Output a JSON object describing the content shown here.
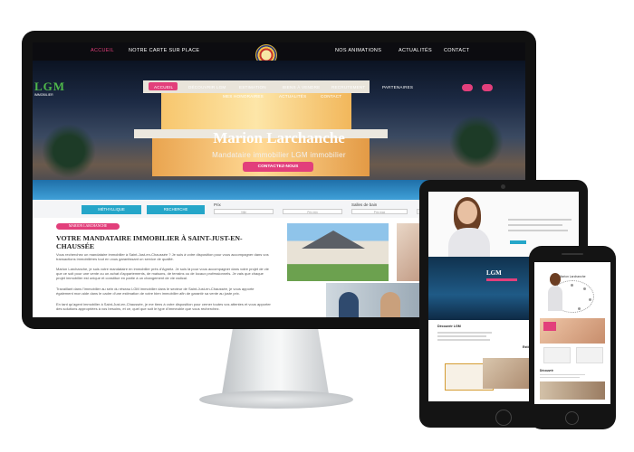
{
  "topbar": {
    "items": [
      "ACCUEIL",
      "NOTRE CARTE SUR PLACE",
      "NOS ANIMATIONS",
      "ACTUALITÉS",
      "CONTACT"
    ],
    "active_color": "#e23f7b"
  },
  "site": {
    "logo_text": "LGM",
    "logo_tagline": "IMMOBILIER",
    "menu_row1": [
      "ACCUEIL",
      "DÉCOUVRIR LGM",
      "ESTIMATION",
      "BIENS À VENDRE",
      "RECRUTEMENT",
      "PARTENAIRES"
    ],
    "menu_row2": [
      "MES HONORAIRES",
      "ACTUALITÉS",
      "CONTACT"
    ],
    "hero_title": "Marion Larchanche",
    "hero_subtitle": "Mandataire immobilier LGM immobilier",
    "hero_button": "CONTACTEZ-NOUS",
    "accent_color": "#e23f7b",
    "secondary_color": "#25a6c9"
  },
  "search": {
    "buttons": [
      "MÉTHYLLIQUE",
      "RECHERCHE"
    ],
    "labels": [
      "Prix",
      "Salles de bain"
    ],
    "inputs": [
      "Ville",
      "Prix min",
      "Prix max",
      "Mini"
    ]
  },
  "content": {
    "pill": "MARION LARCHANCHE",
    "title": "VOTRE MANDATAIRE IMMOBILIER À SAINT-JUST-EN-CHAUSSÉE",
    "paragraphs": [
      "Vous recherchez un mandataire immobilier à Saint-Just-en-Chaussée ? Je suis à votre disposition pour vous accompagner dans vos transactions immobilières tout en vous garantissant un service de qualité.",
      "Marion Larchanche, je suis votre mandataire en immobilier près d'Agnetz. Je suis là pour vous accompagner dans votre projet de vie que ce soit pour une vente ou un achat d'appartements, de maisons, de terrains ou de locaux professionnels. Je vais que chaque projet immobilier est unique et constitue en partie à un changement de vie radical.",
      "Travaillant dans l'immobilier au sein du réseau LGM immobilier dans le secteur de Saint-Just-en-Chaussée, je vous apporte également mon aide dans le cadre d'une estimation de votre bien immobilier afin de garantir sa vente au juste prix.",
      "En tant qu'agent immobilier à Saint-Just-en-Chaussée, je me tiens à votre disposition pour cerner toutes vos attentes et vous apporter des solutions appropriées à vos besoins, et ce, quel que soit le type d'immeuble que vous recherchez."
    ]
  },
  "tablet": {
    "band_logo": "LGM",
    "section_title": "Découvrir LGM",
    "section2": "Estimation"
  },
  "phone": {
    "title": "Marion Larchanche",
    "section": "Découvrir"
  }
}
